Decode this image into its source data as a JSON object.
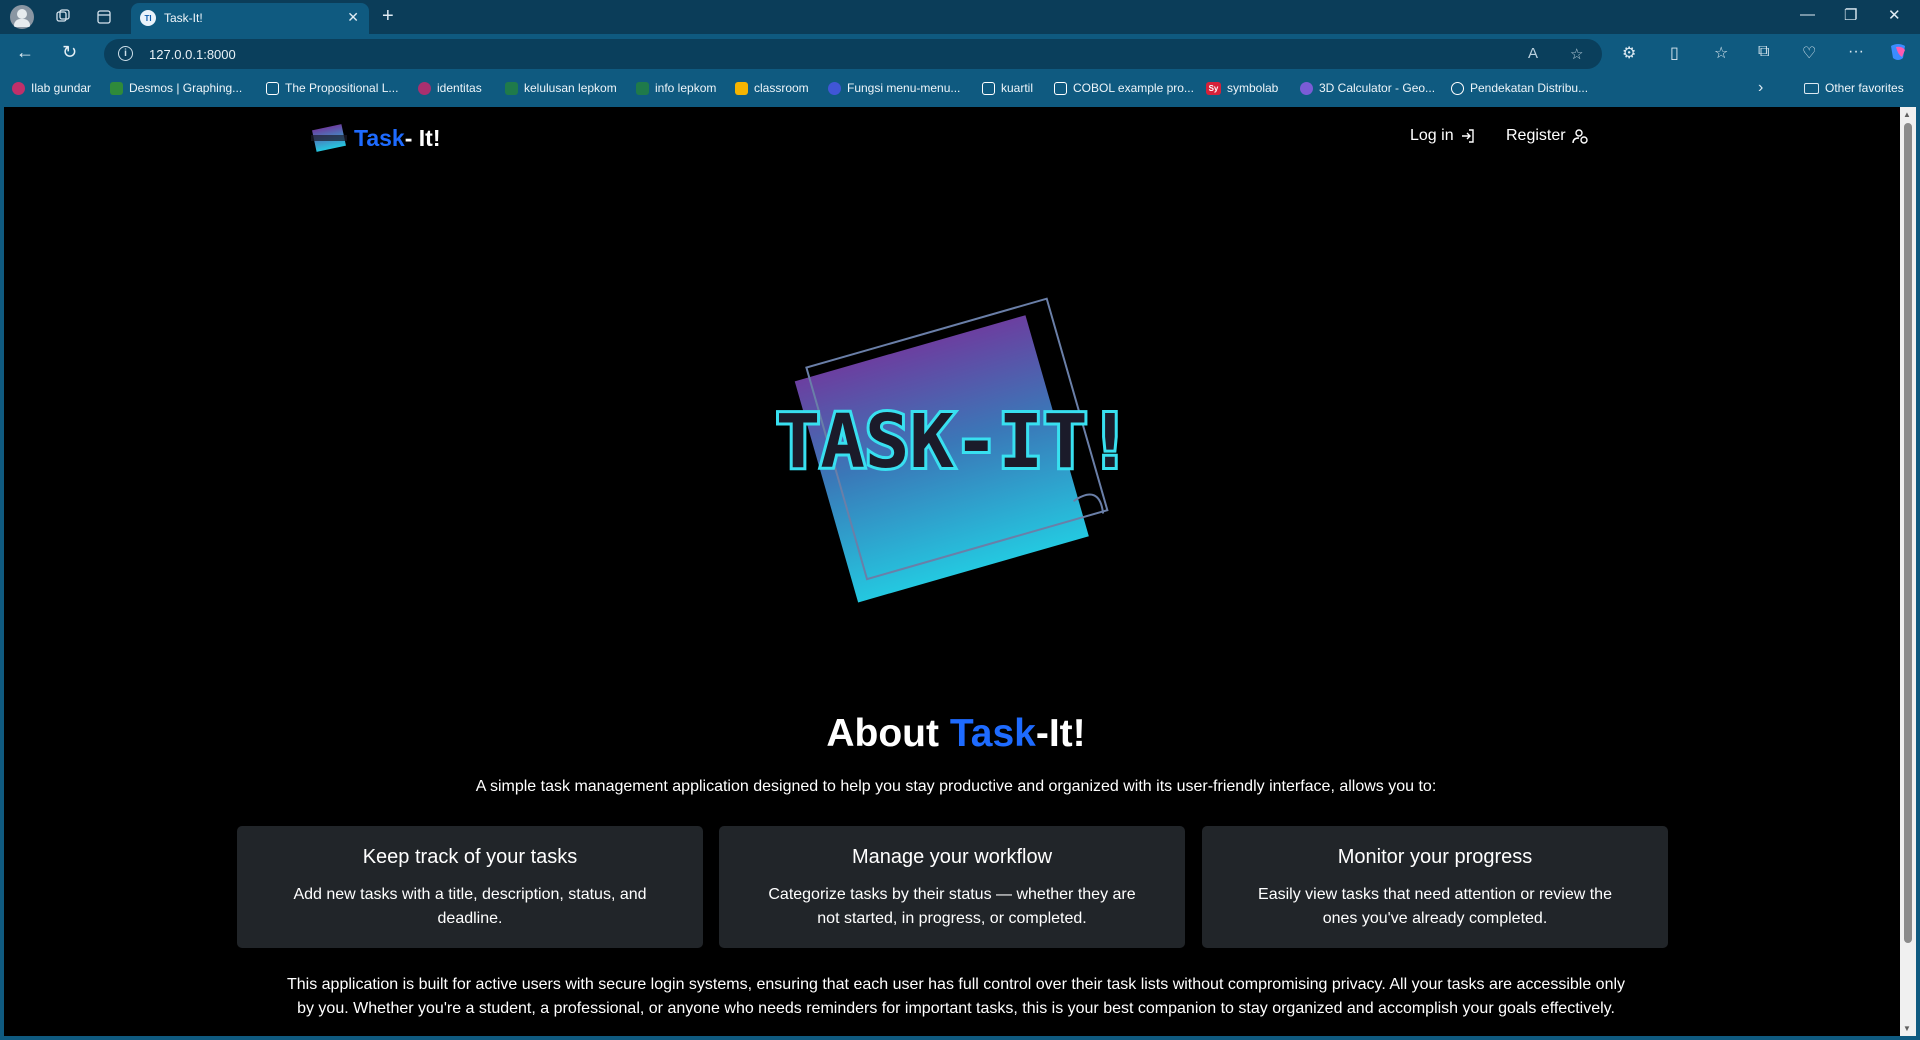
{
  "browser": {
    "tab_title": "Task-It!",
    "tab_favicon_text": "TI",
    "url": "127.0.0.1:8000",
    "bookmarks": [
      {
        "label": "Ilab gundar",
        "color": "#c0306a"
      },
      {
        "label": "Desmos | Graphing...",
        "color": "#2f8a3a"
      },
      {
        "label": "The Propositional L...",
        "color": "#ffffff"
      },
      {
        "label": "identitas",
        "color": "#a8306f"
      },
      {
        "label": "kelulusan lepkom",
        "color": "#1f7a4a"
      },
      {
        "label": "info lepkom",
        "color": "#1f7a4a"
      },
      {
        "label": "classroom",
        "color": "#f6b400"
      },
      {
        "label": "Fungsi menu-menu...",
        "color": "#4056d6"
      },
      {
        "label": "kuartil",
        "color": "#ffffff"
      },
      {
        "label": "COBOL example pro...",
        "color": "#ffffff"
      },
      {
        "label": "symbolab",
        "color": "#d6213a"
      },
      {
        "label": "3D Calculator - Geo...",
        "color": "#7b5cd6"
      },
      {
        "label": "Pendekatan Distribu...",
        "color": "#ffffff"
      }
    ],
    "other_favorites": "Other favorites",
    "symbolab_icon_text": "Sy"
  },
  "header": {
    "brand_part1": "Task",
    "brand_part2": "- It!",
    "login_label": "Log in",
    "register_label": "Register"
  },
  "hero": {
    "logo_text": "TASK-IT!",
    "colors": {
      "top": "#6b3fa0",
      "mid": "#3a78b8",
      "bottom": "#24c8e0",
      "text": "#1b1b2a",
      "glow": "#38e0f0"
    }
  },
  "about": {
    "title_part1": "About ",
    "title_part2": "Task",
    "title_part3": "-It!",
    "subtitle": "A simple task management application designed to help you stay productive and organized with its user-friendly interface, allows you to:",
    "cards": [
      {
        "title": "Keep track of your tasks",
        "text": "Add new tasks with a title, description, status, and deadline."
      },
      {
        "title": "Manage your workflow",
        "text": "Categorize tasks by their status — whether they are not started, in progress, or completed."
      },
      {
        "title": "Monitor your progress",
        "text": "Easily view tasks that need attention or review the ones you've already completed."
      }
    ],
    "footer": "This application is built for active users with secure login systems, ensuring that each user has full control over their task lists without compromising privacy. All your tasks are accessible only by you. Whether you're a student, a professional, or anyone who needs reminders for important tasks, this is your best companion to stay organized and accomplish your goals effectively."
  },
  "colors": {
    "accent": "#1e6bff",
    "card_bg": "#212529",
    "page_bg": "#000000"
  }
}
